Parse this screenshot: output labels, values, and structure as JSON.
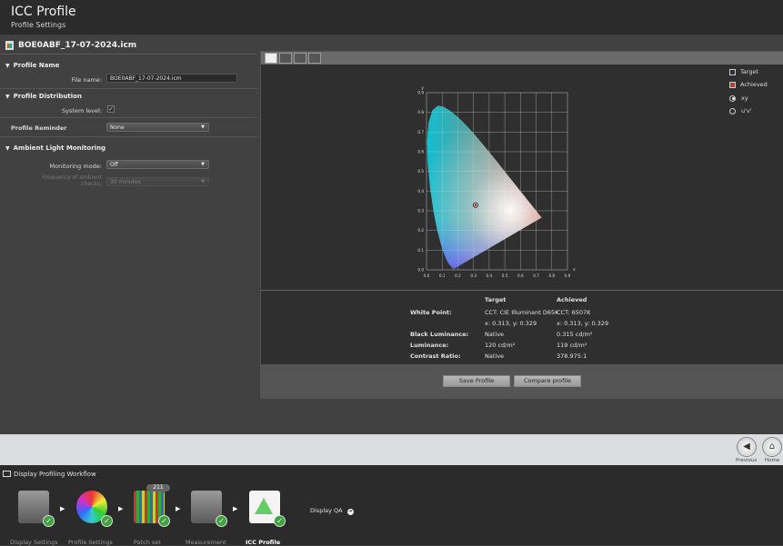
{
  "header": {
    "title": "ICC Profile",
    "subtitle": "Profile Settings"
  },
  "file": {
    "name": "BOE0ABF_17-07-2024.icm"
  },
  "sections": {
    "profile_name": {
      "title": "Profile Name",
      "file_name_label": "File name:",
      "file_name_value": "BOE0ABF_17-07-2024.icm"
    },
    "profile_distribution": {
      "title": "Profile Distribution",
      "system_level_label": "System level:",
      "system_level_checked": true
    },
    "profile_reminder": {
      "label": "Profile Reminder",
      "value": "None"
    },
    "ambient": {
      "title": "Ambient Light Monitoring",
      "mode_label": "Monitoring mode:",
      "mode_value": "Off",
      "freq_label_1": "Frequency of ambient",
      "freq_label_2": "checks:",
      "freq_value": "30 minutes"
    }
  },
  "legend": {
    "target": "Target",
    "achieved": "Achieved",
    "xy": "xy",
    "uv": "u'v'",
    "selected": "xy"
  },
  "chart_data": {
    "type": "scatter",
    "title": "",
    "xlabel": "x",
    "ylabel": "y",
    "xlim": [
      0.0,
      0.9
    ],
    "ylim": [
      0.0,
      0.9
    ],
    "x_ticks": [
      "0.0",
      "0.1",
      "0.2",
      "0.3",
      "0.4",
      "0.5",
      "0.6",
      "0.7",
      "0.8",
      "0.9"
    ],
    "y_ticks": [
      "0.0",
      "0.1",
      "0.2",
      "0.3",
      "0.4",
      "0.5",
      "0.6",
      "0.7",
      "0.8",
      "0.9"
    ],
    "grid": true,
    "series": [
      {
        "name": "Target",
        "x": [
          0.313
        ],
        "y": [
          0.329
        ]
      },
      {
        "name": "Achieved",
        "x": [
          0.313
        ],
        "y": [
          0.329
        ]
      }
    ]
  },
  "table": {
    "col_target": "Target",
    "col_achieved": "Achieved",
    "rows": [
      {
        "label": "White Point:",
        "target": "CCT: CIE Illuminant D65K",
        "achieved": "CCT: 6507K"
      },
      {
        "label": "",
        "target": "x: 0.313, y: 0.329",
        "achieved": "x: 0.313, y: 0.329"
      },
      {
        "label": "Black Luminance:",
        "target": "Native",
        "achieved": "0.315 cd/m²"
      },
      {
        "label": "Luminance:",
        "target": "120 cd/m²",
        "achieved": "119 cd/m²"
      },
      {
        "label": "Contrast Ratio:",
        "target": "Native",
        "achieved": "378.975:1"
      }
    ]
  },
  "buttons": {
    "save": "Save Profile",
    "compare": "Compare profile"
  },
  "nav": {
    "previous": "Previous",
    "home": "Home"
  },
  "workflow": {
    "title": "Display Profiling Workflow",
    "patch_count": "211",
    "steps": [
      "Display Settings",
      "Profile Settings",
      "Patch set",
      "Measurement",
      "ICC Profile"
    ],
    "next": "Display QA"
  }
}
